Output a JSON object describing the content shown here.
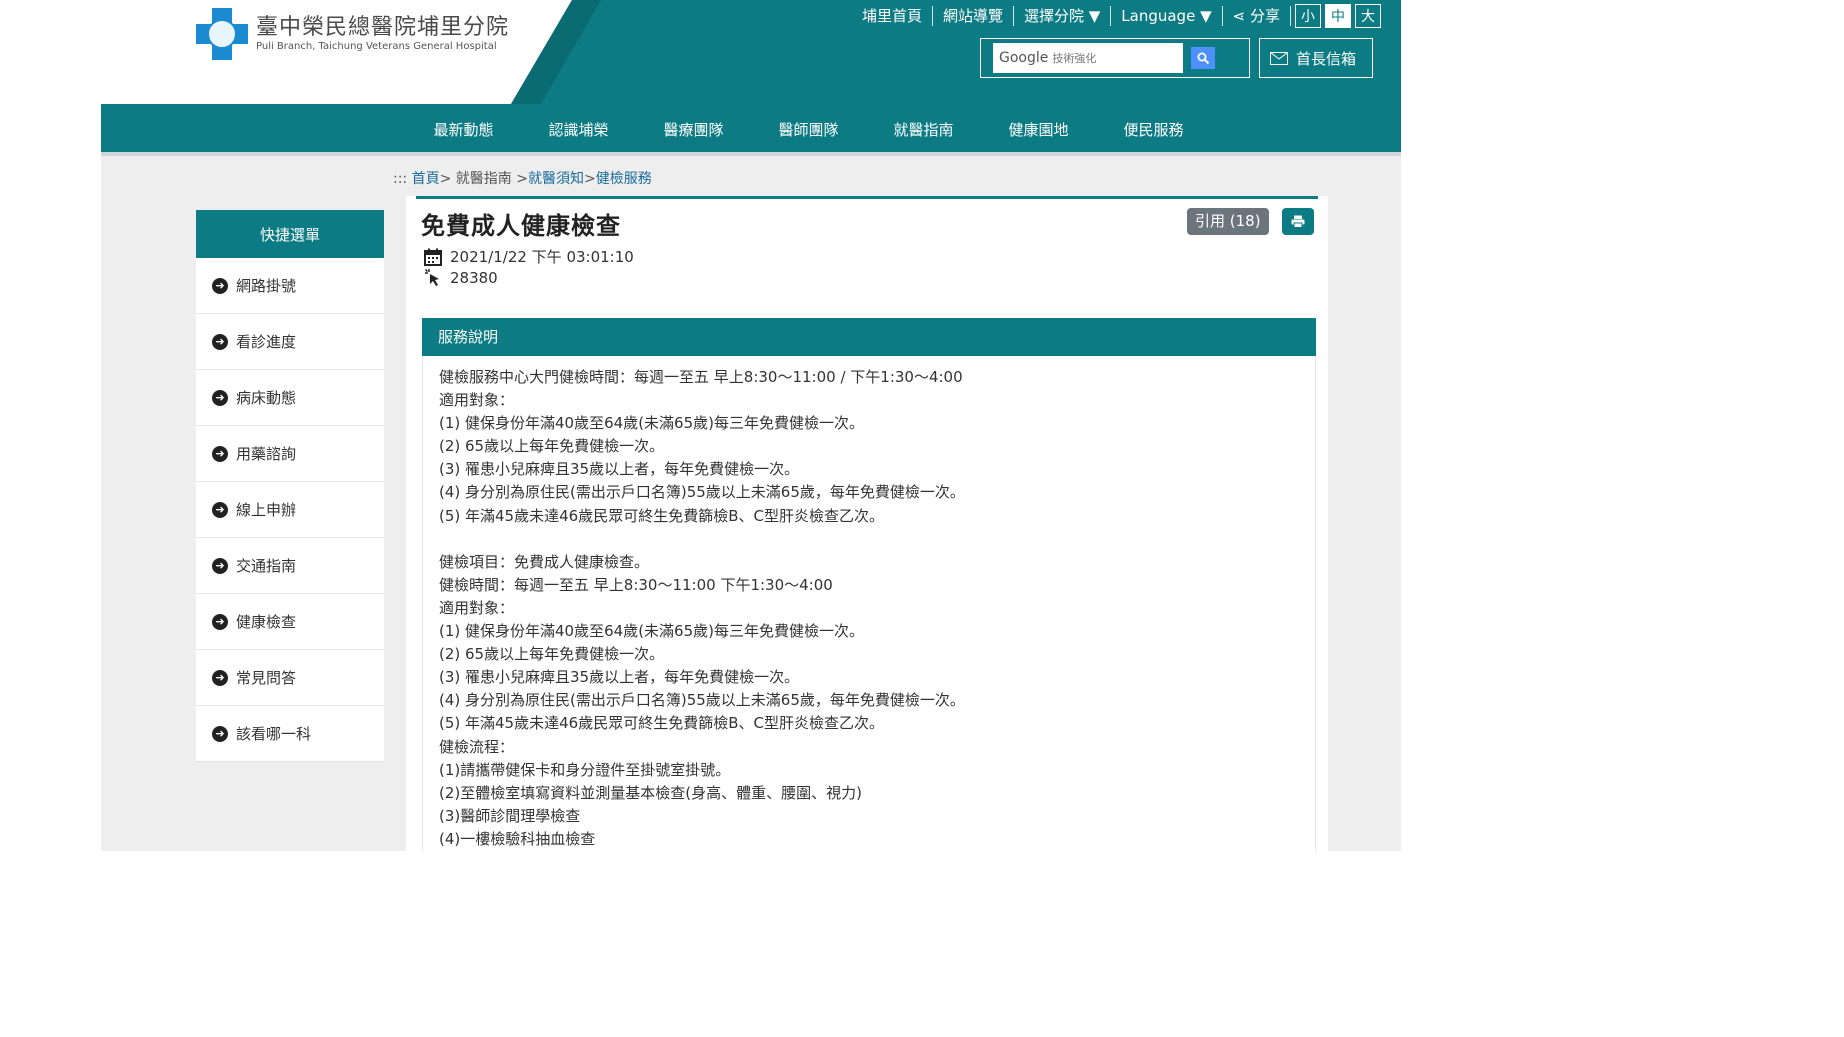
{
  "header": {
    "hospital_name": "臺中榮民總醫院埔里分院",
    "hospital_sub": "Puli Branch, Taichung Veterans General Hospital",
    "links": [
      "埔里首頁",
      "網站導覽",
      "選擇分院 ▼",
      "Language ▼",
      "分享"
    ],
    "font_sizes": [
      "小",
      "中",
      "大"
    ],
    "search_brand": "Google",
    "search_placeholder": "技術強化",
    "mailbox": "首長信箱"
  },
  "nav": [
    "最新動態",
    "認識埔榮",
    "醫療團隊",
    "醫師團隊",
    "就醫指南",
    "健康園地",
    "便民服務"
  ],
  "breadcrumb": {
    "prefix": ":::",
    "home": "首頁",
    "sep1": ">",
    "level1": "就醫指南",
    "sep2": ">",
    "level2": "就醫須知",
    "sep3": ">",
    "level3": "健檢服務"
  },
  "sidebar": {
    "title": "快捷選單",
    "items": [
      "網路掛號",
      "看診進度",
      "病床動態",
      "用藥諮詢",
      "線上申辦",
      "交通指南",
      "健康檢查",
      "常見問答",
      "該看哪一科"
    ]
  },
  "article": {
    "title": "免費成人健康檢查",
    "cite": "引用 (18)",
    "date": "2021/1/22 下午 03:01:10",
    "views": "28380",
    "section_title": "服務說明",
    "lines": [
      "健檢服務中心大門健檢時間：每週一至五 早上8:30～11:00 / 下午1:30～4:00",
      "適用對象：",
      "(1) 健保身份年滿40歲至64歲(未滿65歲)每三年免費健檢一次。",
      "(2) 65歲以上每年免費健檢一次。",
      "(3) 罹患小兒麻痺且35歲以上者，每年免費健檢一次。",
      "(4) 身分別為原住民(需出示戶口名簿)55歲以上未滿65歲，每年免費健檢一次。",
      "(5) 年滿45歲未達46歲民眾可終生免費篩檢B、C型肝炎檢查乙次。",
      "",
      "健檢項目：免費成人健康檢查。",
      "健檢時間：每週一至五 早上8:30～11:00 下午1:30～4:00",
      "適用對象：",
      "(1) 健保身份年滿40歲至64歲(未滿65歲)每三年免費健檢一次。",
      "(2) 65歲以上每年免費健檢一次。",
      "(3) 罹患小兒麻痺且35歲以上者，每年免費健檢一次。",
      "(4) 身分別為原住民(需出示戶口名簿)55歲以上未滿65歲，每年免費健檢一次。",
      "(5) 年滿45歲未達46歲民眾可終生免費篩檢B、C型肝炎檢查乙次。",
      "健檢流程：",
      "(1)請攜帶健保卡和身分證件至掛號室掛號。",
      "(2)至體檢室填寫資料並測量基本檢查(身高、體重、腰圍、視力)",
      "(3)醫師診間理學檢查",
      "(4)一樓檢驗科抽血檢查"
    ]
  },
  "colors": {
    "teal": "#0c7b84",
    "cite_gray": "#6c757d"
  },
  "icons": [
    "search-icon",
    "mail-icon",
    "share-icon",
    "calendar-icon",
    "click-icon",
    "print-icon",
    "arrow-right-circle-icon"
  ]
}
